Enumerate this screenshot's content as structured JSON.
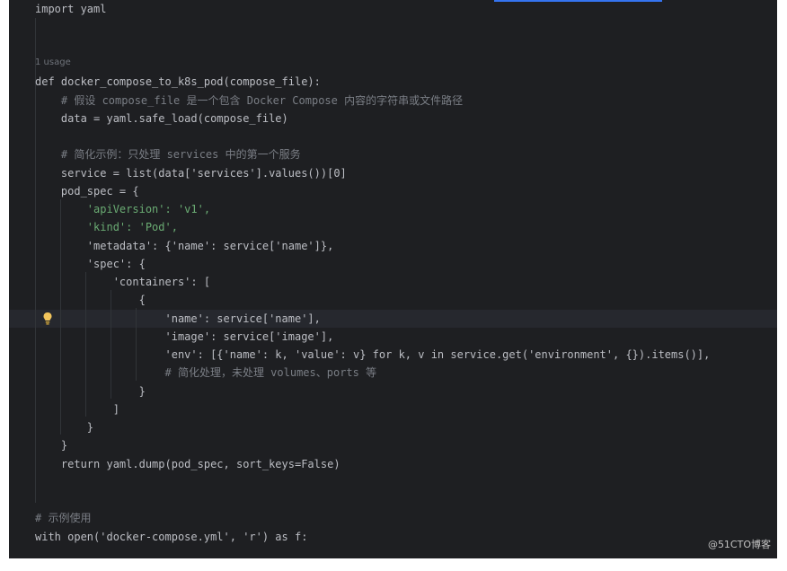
{
  "editor": {
    "usage_hint": "1 usage",
    "watermark": "@51CTO博客",
    "lines": [
      {
        "id": "l1",
        "text": "import yaml"
      },
      {
        "id": "l2",
        "text": "def docker_compose_to_k8s_pod(compose_file):"
      },
      {
        "id": "l3",
        "text": "    # 假设 compose_file 是一个包含 Docker Compose 内容的字符串或文件路径"
      },
      {
        "id": "l4",
        "text": "    data = yaml.safe_load(compose_file)"
      },
      {
        "id": "l5",
        "text": "    # 简化示例：只处理 services 中的第一个服务"
      },
      {
        "id": "l6",
        "text": "    service = list(data['services'].values())[0]"
      },
      {
        "id": "l7",
        "text": "    pod_spec = {"
      },
      {
        "id": "l8",
        "text": "        'apiVersion': 'v1',"
      },
      {
        "id": "l9",
        "text": "        'kind': 'Pod',"
      },
      {
        "id": "l10",
        "text": "        'metadata': {'name': service['name']},"
      },
      {
        "id": "l11",
        "text": "        'spec': {"
      },
      {
        "id": "l12",
        "text": "            'containers': ["
      },
      {
        "id": "l13",
        "text": "                {"
      },
      {
        "id": "l14",
        "text": "                    'name': service['name'],"
      },
      {
        "id": "l15",
        "text": "                    'image': service['image'],"
      },
      {
        "id": "l16",
        "text": "                    'env': [{'name': k, 'value': v} for k, v in service.get('environment', {}).items()],"
      },
      {
        "id": "l17",
        "text": "                    # 简化处理，未处理 volumes、ports 等"
      },
      {
        "id": "l18",
        "text": "                }"
      },
      {
        "id": "l19",
        "text": "            ]"
      },
      {
        "id": "l20",
        "text": "        }"
      },
      {
        "id": "l21",
        "text": "    }"
      },
      {
        "id": "l22",
        "text": "    return yaml.dump(pod_spec, sort_keys=False)"
      },
      {
        "id": "l23",
        "text": "# 示例使用"
      },
      {
        "id": "l24",
        "text": "with open('docker-compose.yml', 'r') as f:"
      }
    ]
  },
  "colors": {
    "background": "#1e1f22",
    "keyword": "#cf8e6d",
    "function": "#56a8f5",
    "string": "#6aab73",
    "comment": "#7a7e85",
    "builtin": "#8888c6",
    "parameter": "#aa4926",
    "number": "#2aacb8"
  },
  "icons": {
    "intention": "lightbulb-icon"
  }
}
